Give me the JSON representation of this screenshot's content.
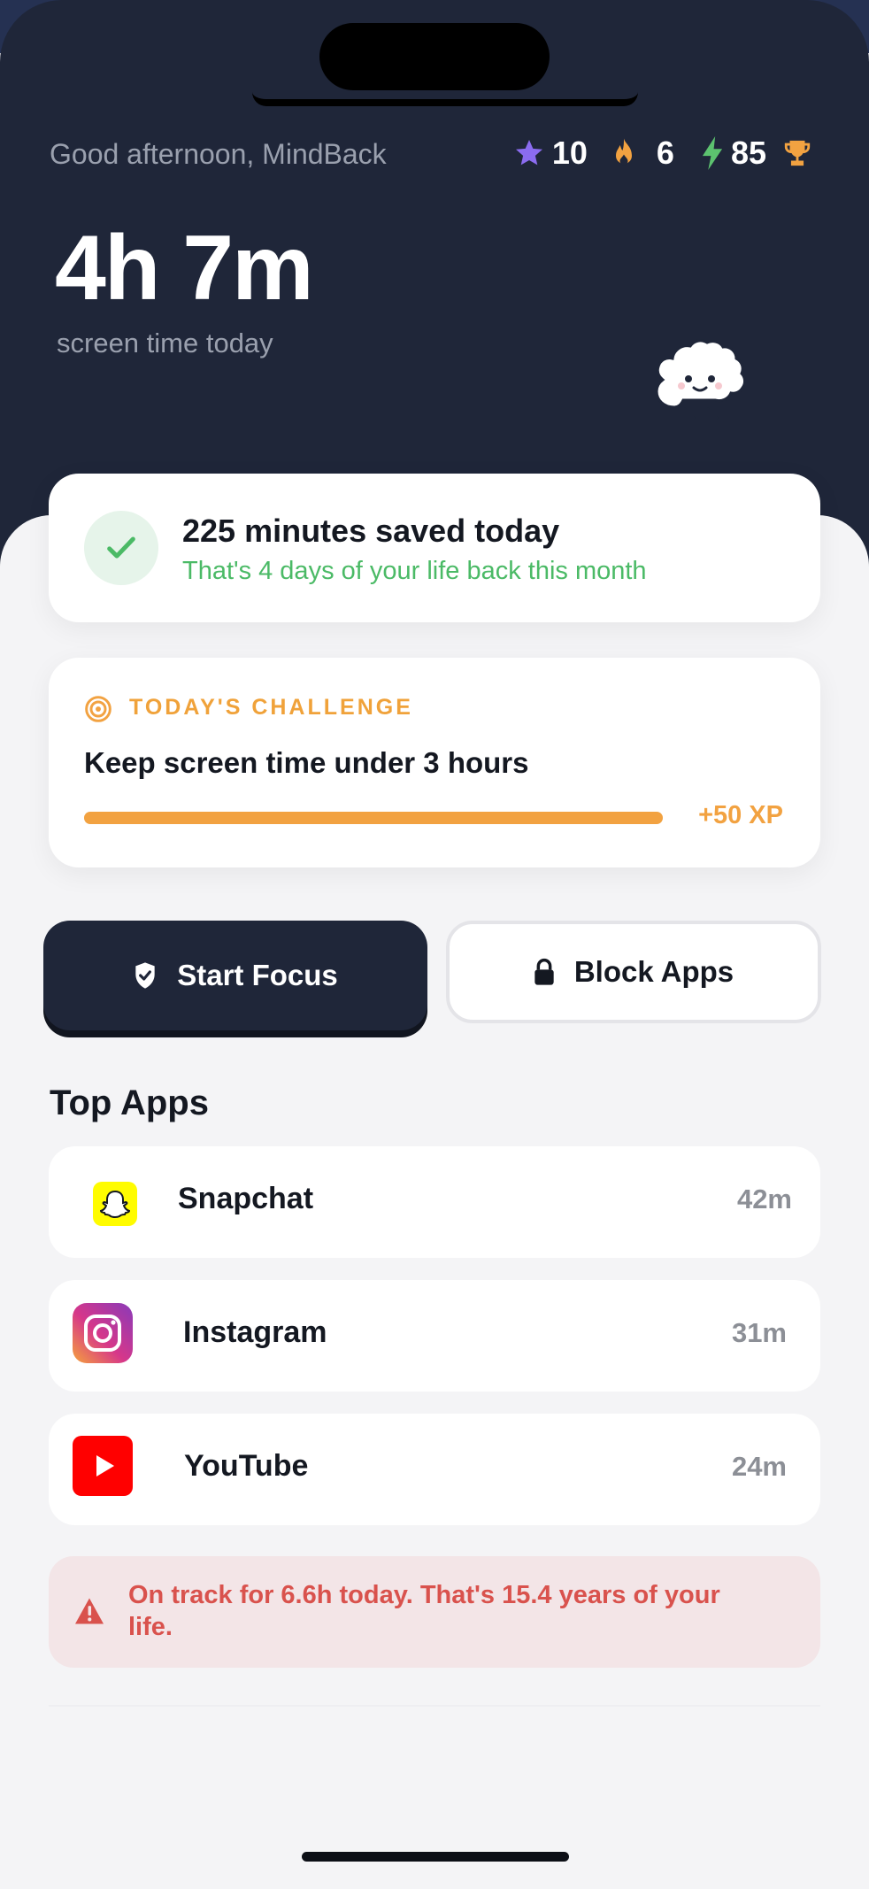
{
  "header": {
    "greeting": "Good afternoon, MindBack",
    "stats": {
      "stars": "10",
      "streak": "6",
      "energy": "85"
    },
    "screen_time": "4h 7m",
    "screen_time_label": "screen time today"
  },
  "saved": {
    "title": "225 minutes saved today",
    "subtitle": "That's 4 days of your life back this month"
  },
  "challenge": {
    "label": "TODAY'S CHALLENGE",
    "title": "Keep screen time under 3 hours",
    "progress": 1.0,
    "reward": "+50 XP"
  },
  "actions": {
    "focus_label": "Start Focus",
    "block_label": "Block Apps"
  },
  "top_apps": {
    "title": "Top Apps",
    "items": [
      {
        "name": "Snapchat",
        "time": "42m",
        "icon": "snapchat-icon"
      },
      {
        "name": "Instagram",
        "time": "31m",
        "icon": "instagram-icon"
      },
      {
        "name": "YouTube",
        "time": "24m",
        "icon": "youtube-icon"
      }
    ]
  },
  "warning": {
    "text": "On track for 6.6h today. That's 15.4 years of your life."
  },
  "colors": {
    "header_bg": "#1f2639",
    "accent_orange": "#f2a241",
    "success_green": "#4bba66",
    "warning_red": "#d9524d"
  }
}
